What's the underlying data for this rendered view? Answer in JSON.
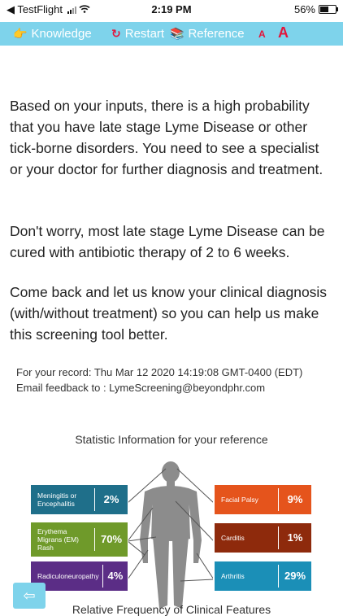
{
  "status_bar": {
    "carrier": "◀ TestFlight",
    "time": "2:19 PM",
    "battery_text": "56%",
    "battery_level": 0.56
  },
  "toolbar": {
    "knowledge": "Knowledge",
    "restart": "Restart",
    "reference": "Reference",
    "font_small": "A",
    "font_large": "A",
    "knowledge_icon": "pointing-hand-icon",
    "restart_icon": "restart-icon",
    "reference_icon": "books-icon",
    "accent": "#7ed3eb",
    "font_color": "#e3163b"
  },
  "result": {
    "paragraph1": "Based on your inputs, there is a high probability that you have late stage Lyme Disease or other tick-borne disorders. You need to see a specialist or your doctor for further diagnosis and treatment.",
    "paragraph2": "Don't worry, most late stage Lyme Disease can be cured with antibiotic therapy of 2 to 6 weeks.",
    "paragraph3": "Come back and let us know your clinical diagnosis (with/without treatment) so you can help us make this screening tool better."
  },
  "record": {
    "timestamp_line": "For your record: Thu Mar 12 2020 14:19:08 GMT-0400 (EDT)",
    "email_line": "Email feedback to :   LymeScreening@beyondphr.com"
  },
  "statistics": {
    "title": "Statistic Information for your reference",
    "caption": "Relative Frequency of Clinical Features",
    "features": [
      {
        "label": "Meningitis or Encephalitis",
        "percent": "2%",
        "color": "#1f6f8a"
      },
      {
        "label": "Erythema Migrans (EM) Rash",
        "percent": "70%",
        "color": "#6f9a2a"
      },
      {
        "label": "Radiculoneuropathy",
        "percent": "4%",
        "color": "#5b2d86"
      },
      {
        "label": "Facial Palsy",
        "percent": "9%",
        "color": "#e5541c"
      },
      {
        "label": "Carditis",
        "percent": "1%",
        "color": "#8e2a0c"
      },
      {
        "label": "Arthritis",
        "percent": "29%",
        "color": "#1b8fb7"
      }
    ]
  },
  "back_button": {
    "icon": "back-arrow-icon"
  }
}
